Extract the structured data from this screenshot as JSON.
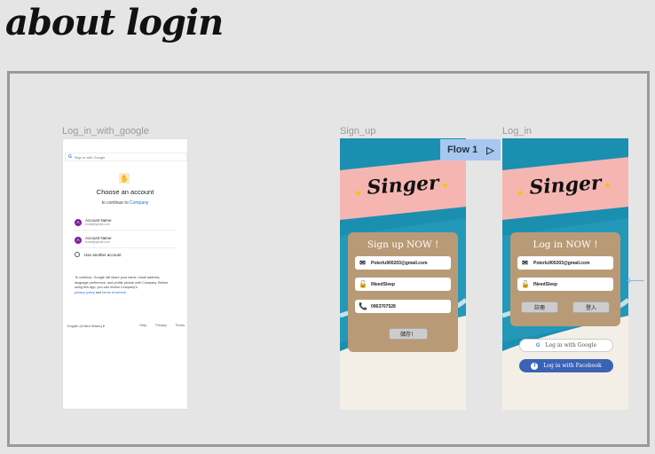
{
  "page_title": "about login",
  "frames": {
    "google_label": "Log_in_with_google",
    "signup_label": "Sign_up",
    "login_label": "Log_in"
  },
  "flow_badge": "Flow 1",
  "google": {
    "top_bar": "Sign in with Google",
    "heading": "Choose an account",
    "continue_prefix": "to continue to",
    "continue_link": "Company",
    "accounts": [
      {
        "initial": "A",
        "name": "Account Name",
        "email": "email@gmail.com"
      },
      {
        "initial": "A",
        "name": "Account Name",
        "email": "email@gmail.com"
      }
    ],
    "use_another": "Use another account",
    "consent": "To continue, Google will share your name, email address, language preference, and profile picture with Company. Before using this app, you can review Company's",
    "privacy": "privacy policy",
    "and": "and",
    "terms": "terms of service",
    "footer_lang": "English (United States)",
    "footer_help": "Help",
    "footer_privacy": "Privacy",
    "footer_terms": "Terms"
  },
  "signup": {
    "brand": "Singer",
    "title": "Sign up NOW !",
    "email": "Poterlu900203@gmail.com",
    "password": "INeedSleep",
    "phone": "0963707528",
    "save_button": "儲存！"
  },
  "login": {
    "brand": "Singer",
    "title": "Log in NOW !",
    "email": "Poterlu900203@gmail.com",
    "password": "INeedSleep",
    "register_button": "註冊",
    "login_button": "登入",
    "google_button": "Log in with Google",
    "facebook_button": "Log in with Facebook"
  },
  "colors": {
    "banner": "#f5b6b2",
    "card": "#b99a76",
    "ocean": "#1a8fb0",
    "facebook": "#3b63b5",
    "flow": "#a8c7f0"
  }
}
